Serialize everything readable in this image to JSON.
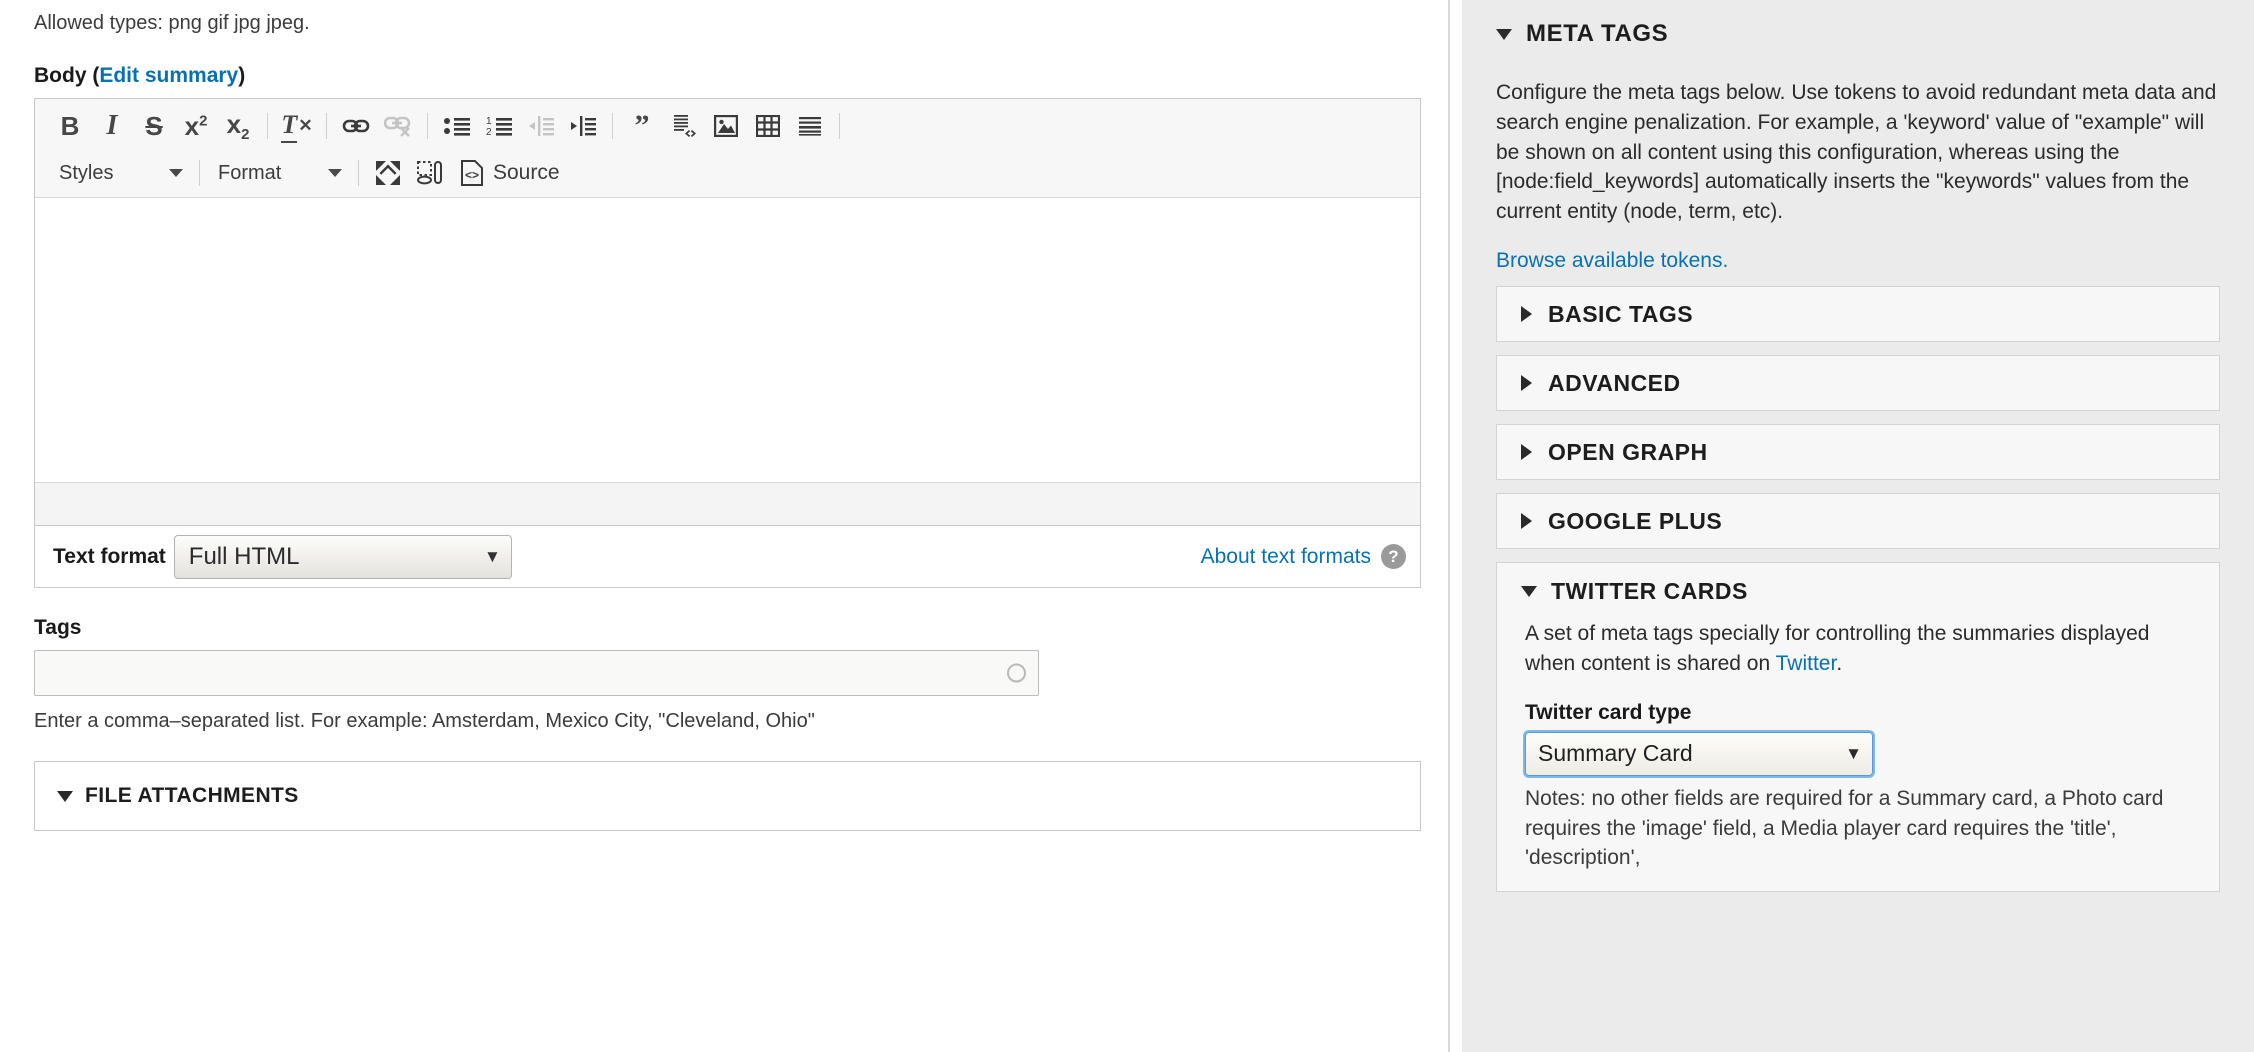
{
  "left": {
    "allowed_types": "Allowed types: png gif jpg jpeg.",
    "body_label": "Body",
    "body_edit_summary": "Edit summary",
    "body_paren_open": "(",
    "body_paren_close": ")",
    "toolbar_row1": [
      {
        "name": "bold-icon",
        "label": "B",
        "kind": "text-bold",
        "disabled": false
      },
      {
        "name": "italic-icon",
        "label": "I",
        "kind": "text-italic",
        "disabled": false
      },
      {
        "name": "strikethrough-icon",
        "label": "S",
        "kind": "text-strike",
        "disabled": false
      },
      {
        "name": "superscript-icon",
        "label": "x2",
        "kind": "superscript",
        "disabled": false
      },
      {
        "name": "subscript-icon",
        "label": "x2",
        "kind": "subscript",
        "disabled": false
      },
      {
        "name": "separator",
        "kind": "sep"
      },
      {
        "name": "remove-format-icon",
        "label": "Tx",
        "kind": "remove-format",
        "disabled": false
      },
      {
        "name": "separator",
        "kind": "sep"
      },
      {
        "name": "link-icon",
        "kind": "link",
        "disabled": false
      },
      {
        "name": "unlink-icon",
        "kind": "unlink",
        "disabled": true
      },
      {
        "name": "separator",
        "kind": "sep"
      },
      {
        "name": "bulleted-list-icon",
        "kind": "ul",
        "disabled": false
      },
      {
        "name": "numbered-list-icon",
        "kind": "ol",
        "disabled": false
      },
      {
        "name": "outdent-icon",
        "kind": "outdent",
        "disabled": true
      },
      {
        "name": "indent-icon",
        "kind": "indent",
        "disabled": false
      },
      {
        "name": "separator",
        "kind": "sep"
      },
      {
        "name": "blockquote-icon",
        "kind": "quote",
        "disabled": false
      },
      {
        "name": "code-block-icon",
        "kind": "codeblock",
        "disabled": false
      },
      {
        "name": "image-icon",
        "kind": "image",
        "disabled": false
      },
      {
        "name": "table-icon",
        "kind": "table",
        "disabled": false
      },
      {
        "name": "horizontal-rule-icon",
        "kind": "hr",
        "disabled": false
      },
      {
        "name": "separator",
        "kind": "sep"
      }
    ],
    "styles_dropdown": "Styles",
    "format_dropdown": "Format",
    "maximize_icon": "maximize-icon",
    "show_blocks_icon": "show-blocks-icon",
    "source_button": "Source",
    "text_format_label": "Text format",
    "text_format_value": "Full HTML",
    "text_format_options": [
      "Full HTML"
    ],
    "about_text_formats": "About text formats",
    "help_icon": "question-mark-icon",
    "tags_label": "Tags",
    "tags_value": "",
    "tags_help": "Enter a comma–separated list. For example: Amsterdam, Mexico City, \"Cleveland, Ohio\"",
    "file_attachments_title": "FILE ATTACHMENTS"
  },
  "sidebar": {
    "meta_tags_title": "META TAGS",
    "meta_tags_desc": "Configure the meta tags below. Use tokens to avoid redundant meta data and search engine penalization. For example, a 'keyword' value of \"example\" will be shown on all content using this configuration, whereas using the [node:field_keywords] automatically inserts the \"keywords\" values from the current entity (node, term, etc).",
    "browse_tokens": "Browse available tokens.",
    "sections": [
      {
        "title": "BASIC TAGS",
        "expanded": false
      },
      {
        "title": "ADVANCED",
        "expanded": false
      },
      {
        "title": "OPEN GRAPH",
        "expanded": false
      },
      {
        "title": "GOOGLE PLUS",
        "expanded": false
      }
    ],
    "twitter": {
      "title": "TWITTER CARDS",
      "desc_before_link": "A set of meta tags specially for controlling the summaries displayed when content is shared on ",
      "desc_link": "Twitter",
      "desc_after_link": ".",
      "card_type_label": "Twitter card type",
      "card_type_value": "Summary Card",
      "card_type_options": [
        "Summary Card"
      ],
      "notes": "Notes: no other fields are required for a Summary card, a Photo card requires the 'image' field, a Media player card requires the 'title', 'description',"
    }
  },
  "colors": {
    "link": "#0971b2",
    "sidebar_bg": "#ebebeb",
    "panel_bg": "#f7f7f7",
    "focus_ring": "#7db8e8"
  }
}
